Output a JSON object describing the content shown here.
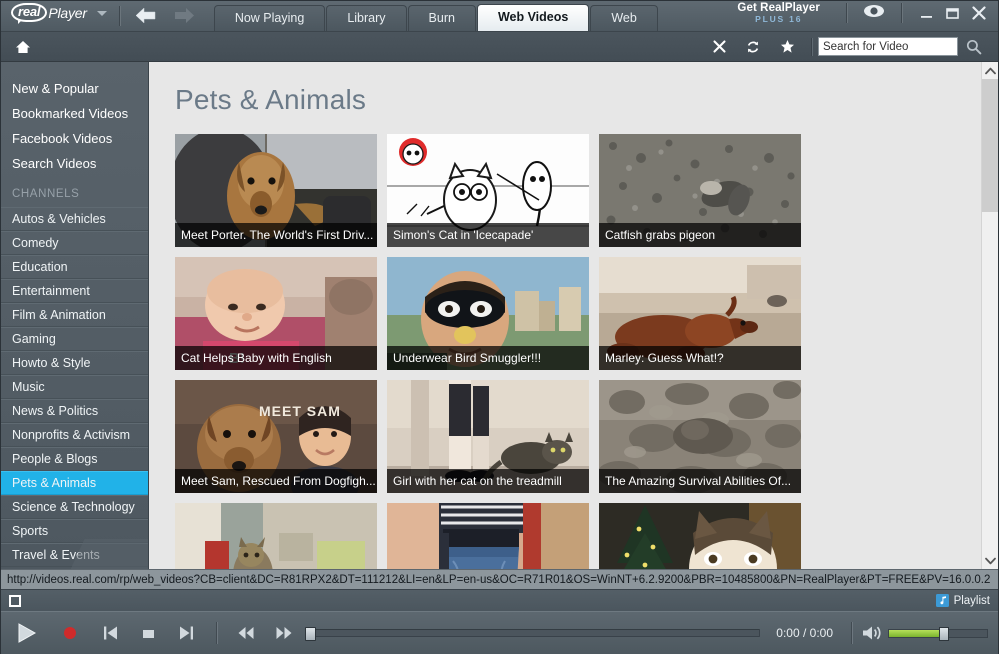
{
  "window": {
    "brand_c": "real",
    "brand_player": "Player",
    "promo_line1": "Get RealPlayer",
    "promo_line2": "PLUS 16",
    "minimize": "minimize",
    "maximize": "maximize",
    "close": "close"
  },
  "tabs": [
    {
      "label": "Now Playing",
      "active": false
    },
    {
      "label": "Library",
      "active": false
    },
    {
      "label": "Burn",
      "active": false
    },
    {
      "label": "Web Videos",
      "active": true
    },
    {
      "label": "Web",
      "active": false
    }
  ],
  "toolbar": {
    "home_icon": "home-icon",
    "stop_icon": "close-x-icon",
    "refresh_icon": "refresh-icon",
    "favorite_icon": "star-icon",
    "search_value": "",
    "search_placeholder": "Search for Video",
    "search_go_icon": "search-icon"
  },
  "sidebar": {
    "links": [
      {
        "label": "New & Popular"
      },
      {
        "label": "Bookmarked Videos"
      },
      {
        "label": "Facebook Videos"
      },
      {
        "label": "Search Videos"
      }
    ],
    "section_label": "CHANNELS",
    "channels": [
      {
        "label": "Autos & Vehicles",
        "active": false
      },
      {
        "label": "Comedy",
        "active": false
      },
      {
        "label": "Education",
        "active": false
      },
      {
        "label": "Entertainment",
        "active": false
      },
      {
        "label": "Film & Animation",
        "active": false
      },
      {
        "label": "Gaming",
        "active": false
      },
      {
        "label": "Howto & Style",
        "active": false
      },
      {
        "label": "Music",
        "active": false
      },
      {
        "label": "News & Politics",
        "active": false
      },
      {
        "label": "Nonprofits & Activism",
        "active": false
      },
      {
        "label": "People & Blogs",
        "active": false
      },
      {
        "label": "Pets & Animals",
        "active": true
      },
      {
        "label": "Science & Technology",
        "active": false
      },
      {
        "label": "Sports",
        "active": false
      },
      {
        "label": "Travel & Events",
        "active": false
      }
    ],
    "highlight_color": "#21b2e8"
  },
  "main": {
    "page_title": "Pets & Animals",
    "videos": [
      {
        "caption": "Meet Porter. The World's First Driv...",
        "scene": "dog-driving-car"
      },
      {
        "caption": "Simon's Cat in 'Icecapade'",
        "scene": "cartoon-cat-sketch"
      },
      {
        "caption": "Catfish grabs pigeon",
        "scene": "catfish-river-gravel"
      },
      {
        "caption": "Cat Helps Baby with English",
        "scene": "baby-with-cat"
      },
      {
        "caption": "Underwear Bird Smuggler!!!",
        "scene": "man-masked-face"
      },
      {
        "caption": "Marley: Guess What!?",
        "scene": "dachshund-on-floor"
      },
      {
        "caption": "Meet Sam, Rescued From Dogfigh...",
        "scene": "dog-and-woman"
      },
      {
        "caption": "Girl with her cat on the treadmill",
        "scene": "legs-cat-treadmill"
      },
      {
        "caption": "The Amazing Survival Abilities Of...",
        "scene": "gray-rock-animal"
      },
      {
        "caption": "",
        "scene": "cat-walking-hallway"
      },
      {
        "caption": "",
        "scene": "person-blue-jeans"
      },
      {
        "caption": "",
        "scene": "husky-christmas-tree"
      }
    ]
  },
  "statusbar": {
    "url": "http://videos.real.com/rp/web_videos?CB=client&DC=R81RPX2&DT=111212&LI=en&LP=en-us&OC=R71R01&OS=WinNT+6.2.9200&PBR=10485800&PN=RealPlayer&PT=FREE&PV=16.0.0.2"
  },
  "playlistbar": {
    "toggle_icon": "square-toggle-icon",
    "playlist_label": "Playlist",
    "playlist_icon": "music-note-icon"
  },
  "player": {
    "play_icon": "play-icon",
    "record_icon": "record-icon",
    "previous_icon": "previous-track-icon",
    "stop_icon": "stop-icon",
    "next_icon": "next-track-icon",
    "rewind_icon": "rewind-icon",
    "forward_icon": "fast-forward-icon",
    "time_display": "0:00 / 0:00",
    "volume_icon": "volume-icon",
    "volume_level": 55,
    "seek_position": 0,
    "record_color": "#d02b2b",
    "volume_color": "#8cc63f"
  }
}
